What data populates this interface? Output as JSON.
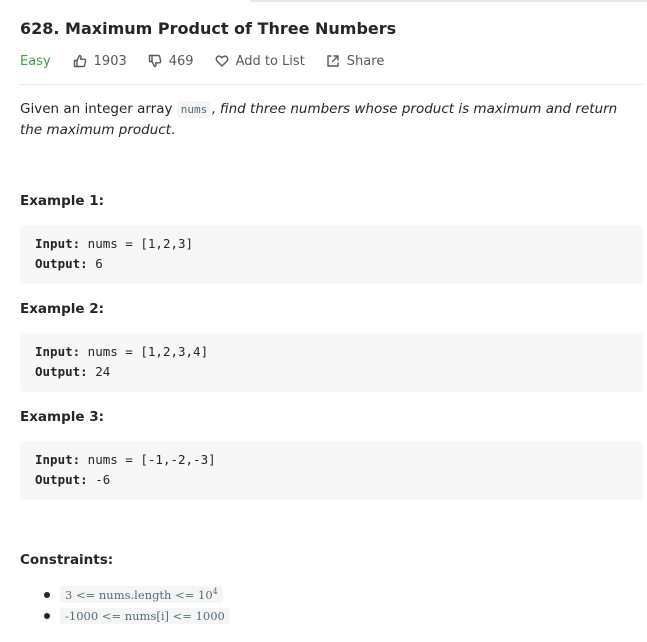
{
  "problem": {
    "title": "628. Maximum Product of Three Numbers",
    "difficulty": "Easy",
    "likes": "1903",
    "dislikes": "469",
    "add_to_list": "Add to List",
    "share": "Share"
  },
  "description": {
    "prefix": "Given an integer array ",
    "code": "nums",
    "sep": ", ",
    "italic": "find three numbers whose product is maximum and return the maximum product",
    "suffix": "."
  },
  "examples": [
    {
      "heading": "Example 1:",
      "input_label": "Input:",
      "input": " nums = [1,2,3]",
      "output_label": "Output:",
      "output": " 6"
    },
    {
      "heading": "Example 2:",
      "input_label": "Input:",
      "input": " nums = [1,2,3,4]",
      "output_label": "Output:",
      "output": " 24"
    },
    {
      "heading": "Example 3:",
      "input_label": "Input:",
      "input": " nums = [-1,-2,-3]",
      "output_label": "Output:",
      "output": " -6"
    }
  ],
  "constraints": {
    "heading": "Constraints:",
    "items": [
      {
        "text": "3 <= nums.length <= 10",
        "sup": "4"
      },
      {
        "text": "-1000 <= nums[i] <= 1000",
        "sup": ""
      }
    ]
  },
  "icons": {
    "like": "thumbs-up-icon",
    "dislike": "thumbs-down-icon",
    "add": "heart-icon",
    "share": "share-icon"
  },
  "colors": {
    "difficulty_easy": "#43a047",
    "inline_code_text": "#546e7a",
    "code_block_bg": "#f7f7f7"
  }
}
